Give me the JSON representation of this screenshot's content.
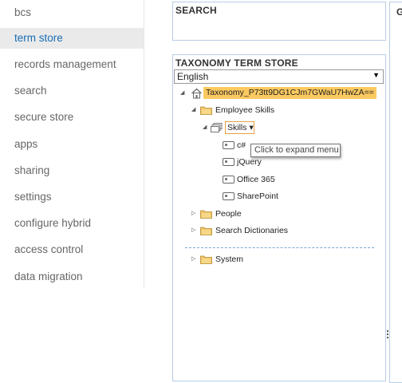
{
  "nav": {
    "items": [
      {
        "label": "bcs",
        "active": false
      },
      {
        "label": "term store",
        "active": true
      },
      {
        "label": "records management",
        "active": false
      },
      {
        "label": "search",
        "active": false
      },
      {
        "label": "secure store",
        "active": false
      },
      {
        "label": "apps",
        "active": false
      },
      {
        "label": "sharing",
        "active": false
      },
      {
        "label": "settings",
        "active": false
      },
      {
        "label": "configure hybrid",
        "active": false
      },
      {
        "label": "access control",
        "active": false
      },
      {
        "label": "data migration",
        "active": false
      }
    ]
  },
  "search_panel": {
    "title": "SEARCH"
  },
  "right_panel": {
    "title": "G"
  },
  "term_store": {
    "title": "TAXONOMY TERM STORE",
    "language": "English",
    "root": "Taxonomy_P73tt9DG1CJm7GWaU7HwZA==",
    "groups": [
      {
        "label": "Employee Skills",
        "expanded": true
      },
      {
        "label": "People",
        "expanded": false
      },
      {
        "label": "Search Dictionaries",
        "expanded": false
      },
      {
        "label": "System",
        "expanded": false
      }
    ],
    "term_set": {
      "label": "Skills",
      "menu_arrow": "▾"
    },
    "terms": [
      "c#",
      "jQuery",
      "Office 365",
      "SharePoint"
    ],
    "tooltip": "Click to expand menu"
  },
  "colors": {
    "accent": "#1a6db3",
    "highlight": "#fbc960",
    "panel_border": "#b7cde4"
  }
}
